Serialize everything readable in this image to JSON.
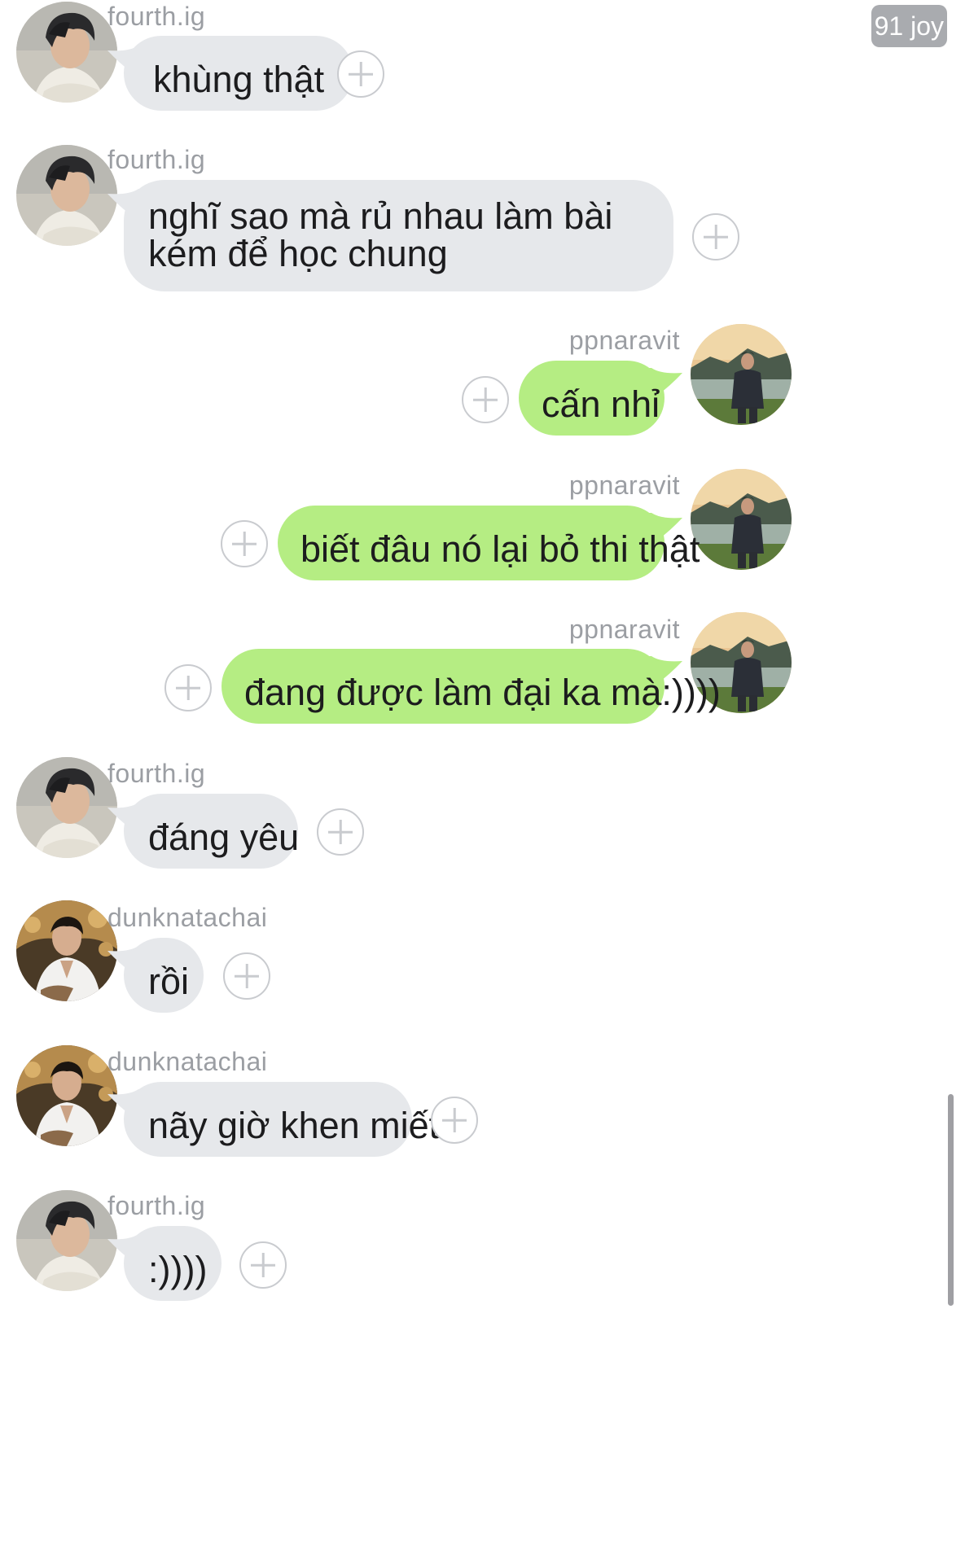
{
  "chat": {
    "unread_badge": "91 joy",
    "messages": [
      {
        "sender": "fourth.ig",
        "text": "khùng thật",
        "side": "incoming",
        "avatar": "avatar-fourth"
      },
      {
        "sender": "fourth.ig",
        "text": "nghĩ sao mà rủ nhau làm bài kém để học chung",
        "side": "incoming",
        "avatar": "avatar-fourth"
      },
      {
        "sender": "ppnaravit",
        "text": "cấn nhỉ",
        "side": "outgoing",
        "avatar": "avatar-ppnaravit"
      },
      {
        "sender": "ppnaravit",
        "text": "biết đâu nó lại bỏ thi thật",
        "side": "outgoing",
        "avatar": "avatar-ppnaravit"
      },
      {
        "sender": "ppnaravit",
        "text": "đang được làm đại ka mà:))))",
        "side": "outgoing",
        "avatar": "avatar-ppnaravit"
      },
      {
        "sender": "fourth.ig",
        "text": "đáng yêu",
        "side": "incoming",
        "avatar": "avatar-fourth"
      },
      {
        "sender": "dunknatachai",
        "text": "rồi",
        "side": "incoming",
        "avatar": "avatar-dunk"
      },
      {
        "sender": "dunknatachai",
        "text": "nãy giờ khen miết",
        "side": "incoming",
        "avatar": "avatar-dunk"
      },
      {
        "sender": "fourth.ig",
        "text": ":))))",
        "side": "incoming",
        "avatar": "avatar-fourth"
      }
    ]
  },
  "colors": {
    "incoming_bubble": "#e6e8eb",
    "outgoing_bubble": "#b5ed83",
    "sender_text": "#9b9ea3",
    "add_button": "#c9cbcf"
  },
  "icons": {
    "add_reaction": "plus-circle-icon"
  }
}
